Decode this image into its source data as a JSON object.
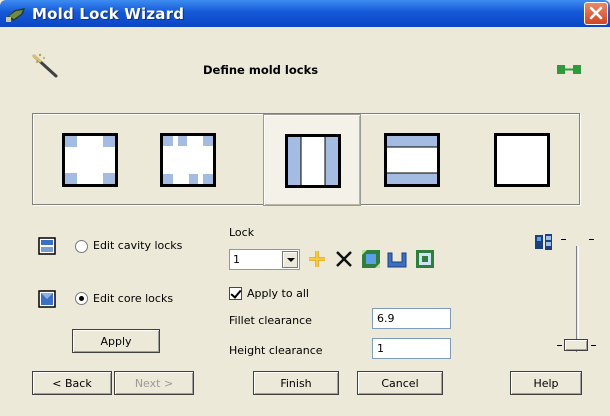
{
  "window": {
    "title": "Mold Lock Wizard"
  },
  "header": {
    "subtitle": "Define mold locks"
  },
  "layout_options": [
    {
      "name": "corner-locks",
      "selected": false
    },
    {
      "name": "side-locks",
      "selected": false
    },
    {
      "name": "vertical-band-locks",
      "selected": true
    },
    {
      "name": "horizontal-band-locks",
      "selected": false
    },
    {
      "name": "no-locks",
      "selected": false
    }
  ],
  "edit_mode": {
    "cavity_label": "Edit cavity locks",
    "core_label": "Edit core locks",
    "selected": "core"
  },
  "lock": {
    "label": "Lock",
    "value": "1",
    "apply_to_all_label": "Apply to all",
    "apply_to_all_checked": true,
    "fillet_label": "Fillet clearance",
    "fillet_value": "6.9",
    "height_label": "Height clearance",
    "height_value": "1"
  },
  "buttons": {
    "apply": "Apply",
    "back": "< Back",
    "next": "Next >",
    "finish": "Finish",
    "cancel": "Cancel",
    "help": "Help"
  },
  "colors": {
    "lock_fill": "#a4bce2",
    "frame": "#000000",
    "title_bar": "#1459d8"
  }
}
